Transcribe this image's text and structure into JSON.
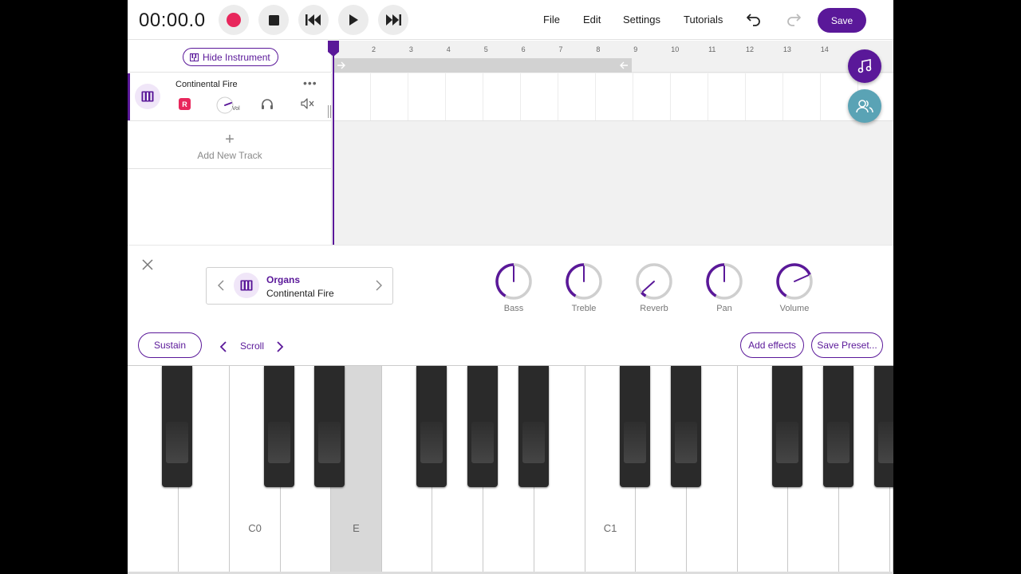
{
  "topbar": {
    "timer": "00:00.0",
    "menu": [
      "File",
      "Edit",
      "Settings",
      "Tutorials"
    ],
    "save_label": "Save"
  },
  "colors": {
    "accent": "#5a1899",
    "record": "#e8275c",
    "fab_collab": "#5aa3b5"
  },
  "tracks_panel": {
    "hide_instrument_label": "Hide Instrument",
    "track": {
      "name": "Continental Fire",
      "rec_badge": "R",
      "vol_label": "Vol"
    },
    "add_track_plus": "+",
    "add_track_label": "Add New Track"
  },
  "ruler": {
    "marks": [
      "2",
      "3",
      "4",
      "5",
      "6",
      "7",
      "8",
      "9",
      "10",
      "11",
      "12",
      "13",
      "14"
    ]
  },
  "instrument_panel": {
    "category": "Organs",
    "preset_name": "Continental Fire",
    "knobs": [
      {
        "label": "Bass",
        "value": 0.5
      },
      {
        "label": "Treble",
        "value": 0.5
      },
      {
        "label": "Reverb",
        "value": 0.06
      },
      {
        "label": "Pan",
        "value": 0.5
      },
      {
        "label": "Volume",
        "value": 0.72
      }
    ],
    "sustain_label": "Sustain",
    "scroll_label": "Scroll",
    "add_effects_label": "Add effects",
    "save_preset_label": "Save Preset..."
  },
  "keyboard": {
    "labels": {
      "c0": "C0",
      "e": "E",
      "c1": "C1"
    },
    "active_key": "E"
  }
}
